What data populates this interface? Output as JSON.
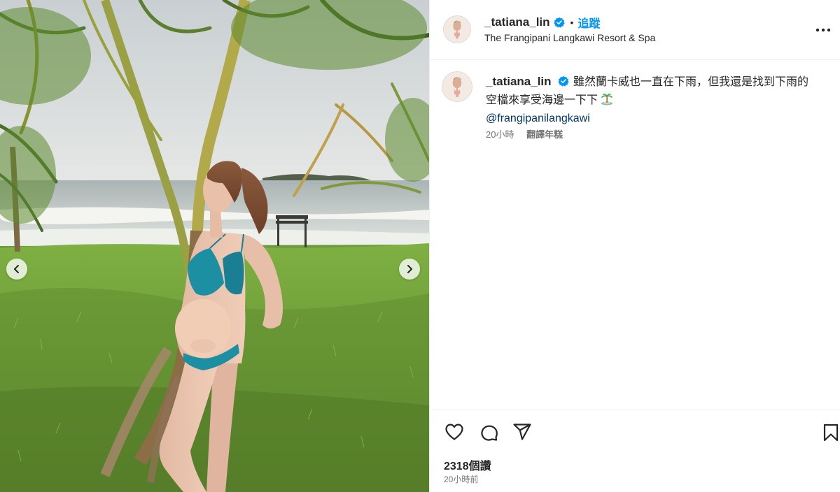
{
  "post": {
    "username": "_tatiana_lin",
    "follow_label": "追蹤",
    "separator": "•",
    "location": "The Frangipani Langkawi Resort & Spa",
    "caption": {
      "text_line1": "雖然蘭卡威也一直在下雨，但我還是找到下雨的",
      "text_line2": "空檔來享受海邊一下下",
      "emoji_icon": "desert-island-icon",
      "mention": "@frangipanilangkawi",
      "age": "20小時",
      "translate_label": "翻譯年糕"
    },
    "views": "2318個讚",
    "timestamp": "20小時前"
  },
  "icons": {
    "verified": "verified-badge-icon",
    "more": "more-options-icon",
    "like": "heart-icon",
    "comment": "comment-icon",
    "share": "paper-plane-icon",
    "save": "bookmark-icon",
    "prev": "chevron-left-icon",
    "next": "chevron-right-icon"
  },
  "colors": {
    "accent": "#0095f6",
    "verified": "#0095f6",
    "mention": "#00376b",
    "secondary_text": "#737373",
    "divider": "#efefef"
  }
}
